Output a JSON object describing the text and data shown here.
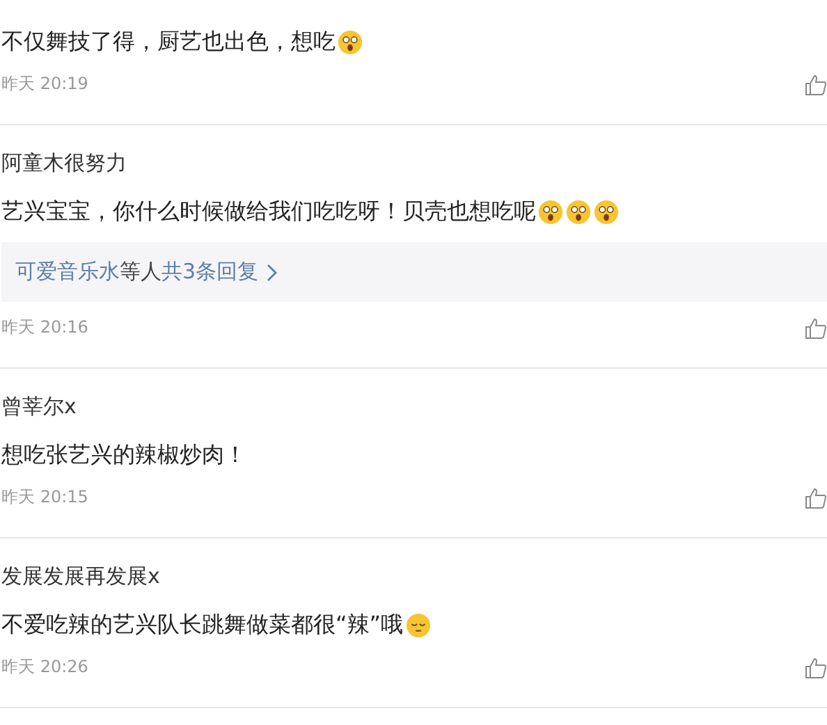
{
  "comments": [
    {
      "text": "不仅舞技了得，厨艺也出色，想吃",
      "emojis": [
        {
          "kind": "shocked"
        }
      ],
      "time": "昨天 20:19"
    },
    {
      "author": "阿童木很努力",
      "text": "艺兴宝宝，你什么时候做给我们吃吃呀！贝壳也想吃呢",
      "emojis": [
        {
          "kind": "shocked"
        },
        {
          "kind": "shocked"
        },
        {
          "kind": "shocked"
        }
      ],
      "replies": {
        "names": "可爱音乐水",
        "suffix": "等人",
        "count": "共3条回复"
      },
      "time": "昨天 20:16"
    },
    {
      "author": "曾莘尔x",
      "text": "想吃张艺兴的辣椒炒肉！",
      "time": "昨天 20:15"
    },
    {
      "author": "发展发展再发展x",
      "text": "不爱吃辣的艺兴队长跳舞做菜都很“辣”哦",
      "emojis": [
        {
          "kind": "sleepy"
        }
      ],
      "time": "昨天 20:26"
    }
  ]
}
